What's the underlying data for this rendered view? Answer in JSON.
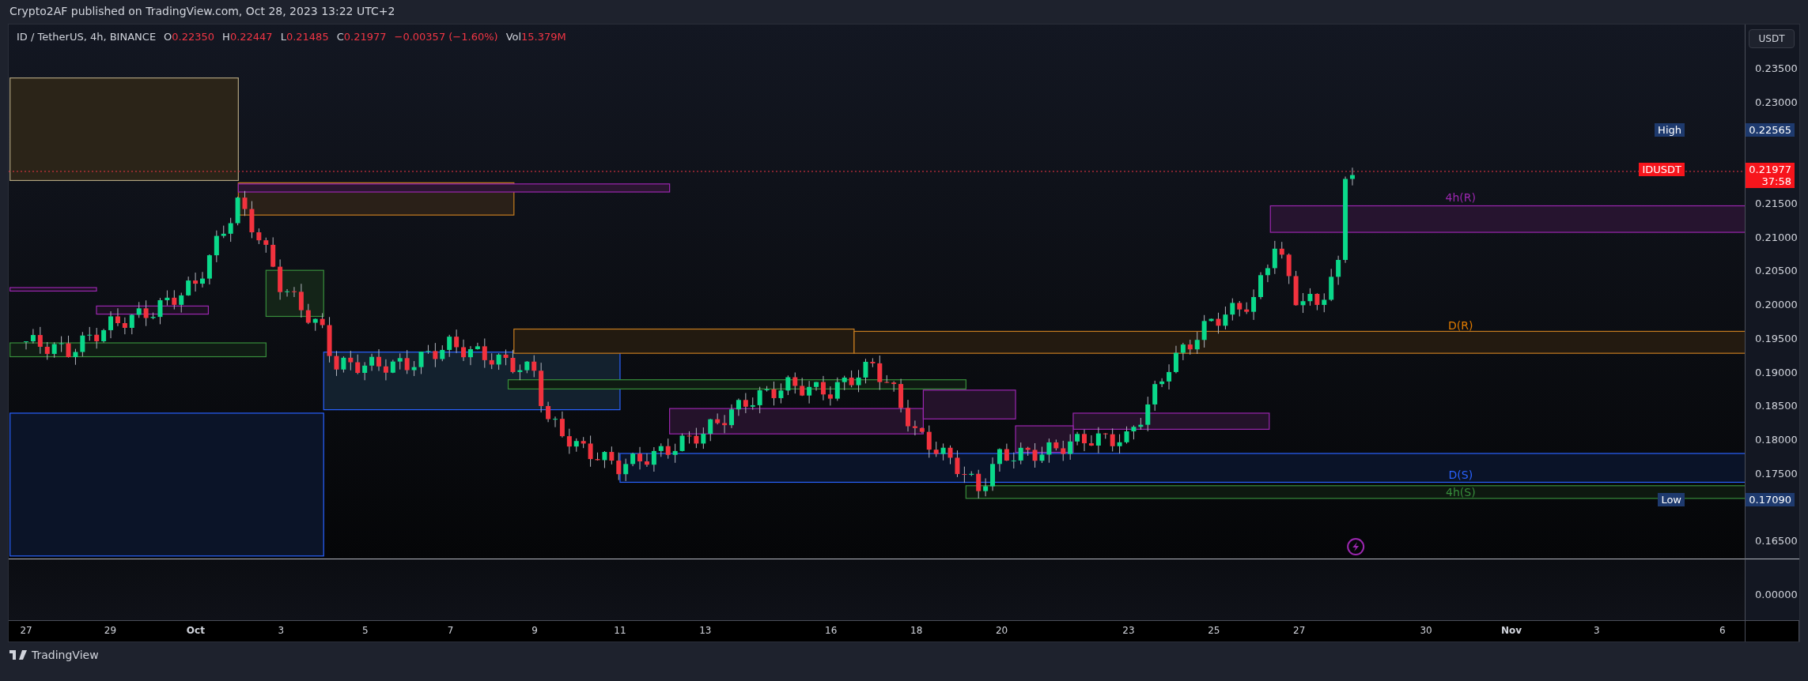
{
  "attribution": "Crypto2AF published on TradingView.com, Oct 28, 2023 13:22 UTC+2",
  "legend": {
    "symbol": "ID / TetherUS, 4h, BINANCE",
    "values": [
      {
        "key": "O",
        "value": "0.22350"
      },
      {
        "key": "H",
        "value": "0.22447"
      },
      {
        "key": "L",
        "value": "0.21485"
      },
      {
        "key": "C",
        "value": "0.21977"
      }
    ],
    "change": "−0.00357 (−1.60%)",
    "volume": {
      "key": "Vol",
      "value": "15.379M"
    }
  },
  "price_axis": {
    "currency": "USDT",
    "ticks": [
      "0.23500",
      "0.23000",
      "0.21500",
      "0.21000",
      "0.20500",
      "0.20000",
      "0.19500",
      "0.19000",
      "0.18500",
      "0.18000",
      "0.17500",
      "0.16500"
    ],
    "badges": [
      {
        "kind": "high",
        "label": "High",
        "value": "0.22565"
      },
      {
        "kind": "last",
        "label": "IDUSDT",
        "value": "0.21977",
        "countdown": "37:58"
      },
      {
        "kind": "low",
        "label": "Low",
        "value": "0.17090"
      }
    ]
  },
  "zone_labels": [
    {
      "text": "4h(R)",
      "color": "#9c27b0"
    },
    {
      "text": "D(R)",
      "color": "#e07b00"
    },
    {
      "text": "D(S)",
      "color": "#2962ff"
    },
    {
      "text": "4h(S)",
      "color": "#388e3c"
    }
  ],
  "lower_pane": {
    "tick": "0.00000"
  },
  "time_axis": [
    {
      "label": "27",
      "bold": false
    },
    {
      "label": "29",
      "bold": false
    },
    {
      "label": "Oct",
      "bold": true
    },
    {
      "label": "3",
      "bold": false
    },
    {
      "label": "5",
      "bold": false
    },
    {
      "label": "7",
      "bold": false
    },
    {
      "label": "9",
      "bold": false
    },
    {
      "label": "11",
      "bold": false
    },
    {
      "label": "13",
      "bold": false
    },
    {
      "label": "16",
      "bold": false
    },
    {
      "label": "18",
      "bold": false
    },
    {
      "label": "20",
      "bold": false
    },
    {
      "label": "23",
      "bold": false
    },
    {
      "label": "25",
      "bold": false
    },
    {
      "label": "27",
      "bold": false
    },
    {
      "label": "30",
      "bold": false
    },
    {
      "label": "Nov",
      "bold": true
    },
    {
      "label": "3",
      "bold": false
    },
    {
      "label": "6",
      "bold": false
    }
  ],
  "footer": {
    "brand": "TradingView"
  }
}
